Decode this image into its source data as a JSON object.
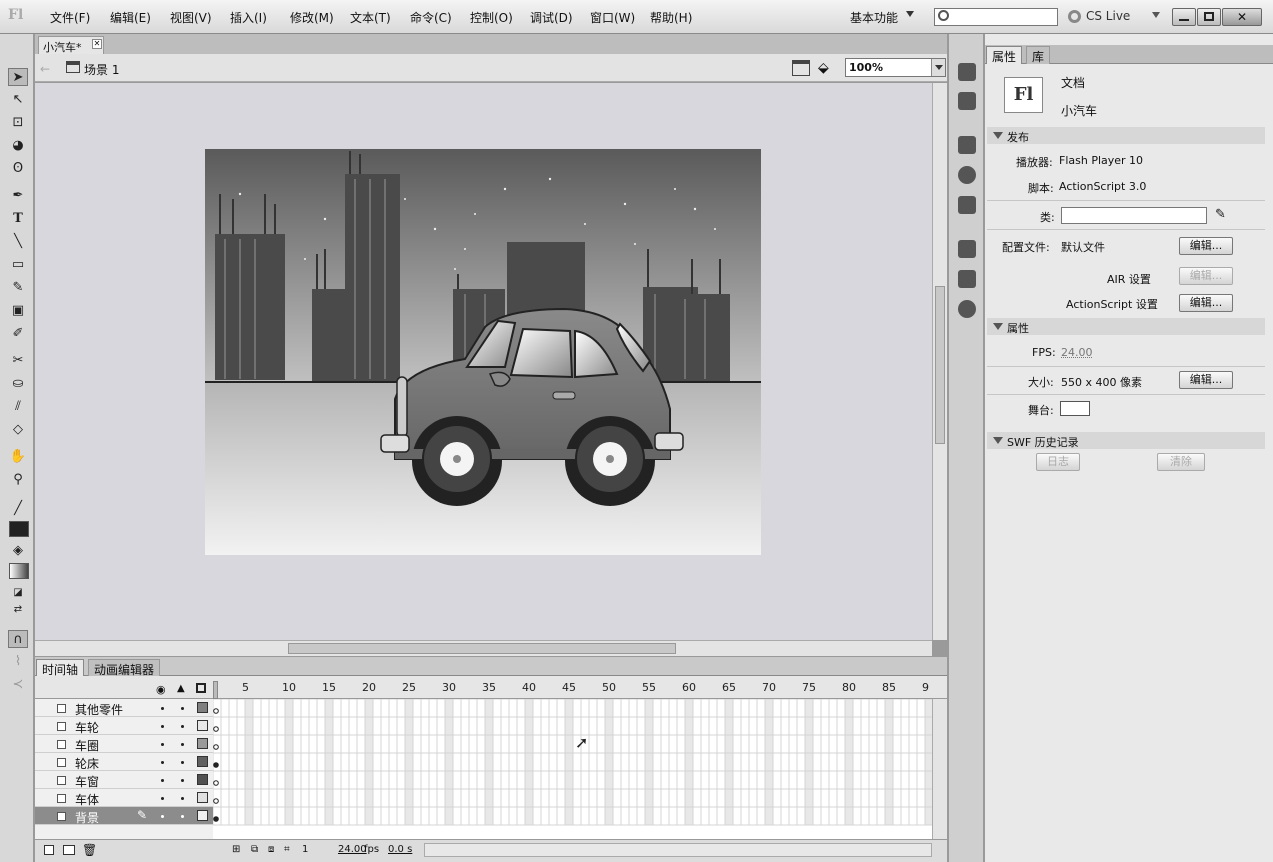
{
  "app": {
    "logo": "Fl"
  },
  "menu": [
    "文件(F)",
    "编辑(E)",
    "视图(V)",
    "插入(I)",
    "修改(M)",
    "文本(T)",
    "命令(C)",
    "控制(O)",
    "调试(D)",
    "窗口(W)",
    "帮助(H)"
  ],
  "workspace": "基本功能",
  "search": {
    "value": ""
  },
  "cslive": "CS Live",
  "document_tab": "小汽车*",
  "scene": "场景 1",
  "zoom": "100%",
  "timeline_tabs": [
    "时间轴",
    "动画编辑器"
  ],
  "frame_numbers": [
    "5",
    "10",
    "15",
    "20",
    "25",
    "30",
    "35",
    "40",
    "45",
    "50",
    "55",
    "60",
    "65",
    "70",
    "75",
    "80",
    "85",
    "9"
  ],
  "layers": [
    {
      "name": "其他零件",
      "color": "#808080"
    },
    {
      "name": "车轮",
      "color": "#e8e8e8"
    },
    {
      "name": "车圈",
      "color": "#9a9a9a"
    },
    {
      "name": "轮床",
      "color": "#606060"
    },
    {
      "name": "车窗",
      "color": "#505050"
    },
    {
      "name": "车体",
      "color": "#e0e0e0"
    },
    {
      "name": "背景",
      "color": "#f0f0f0",
      "selected": true
    }
  ],
  "timeline_status": {
    "frame": "1",
    "fps": "24.00",
    "fps_unit": "fps",
    "time": "0.0 s"
  },
  "panel_tabs": [
    "属性",
    "库"
  ],
  "properties": {
    "doc_label": "文档",
    "doc_name": "小汽车",
    "publish_section": "发布",
    "player_label": "播放器:",
    "player_value": "Flash Player 10",
    "script_label": "脚本:",
    "script_value": "ActionScript 3.0",
    "class_label": "类:",
    "class_value": "",
    "profile_label": "配置文件:",
    "profile_value": "默认文件",
    "edit_label": "编辑...",
    "air_settings": "AIR 设置",
    "as_settings": "ActionScript 设置",
    "props_section": "属性",
    "fps_label": "FPS:",
    "fps_value": "24.00",
    "size_label": "大小:",
    "size_value": "550 x 400 像素",
    "stage_label": "舞台:",
    "swf_section": "SWF 历史记录",
    "log_btn": "日志",
    "clear_btn": "清除"
  }
}
